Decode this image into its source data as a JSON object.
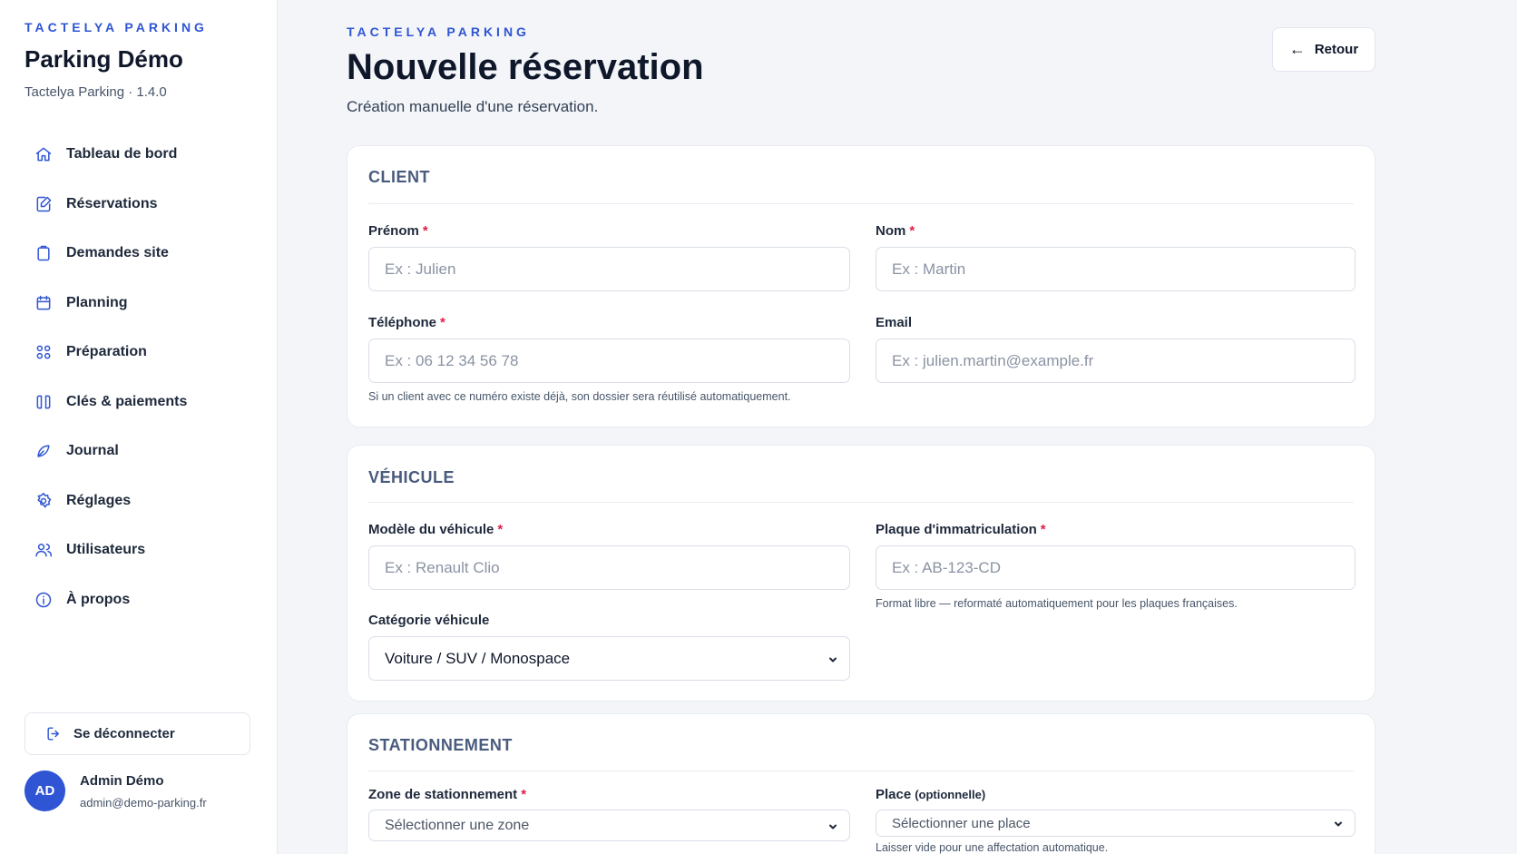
{
  "sidebar": {
    "kicker": "TACTELYA PARKING",
    "title": "Parking Démo",
    "subtitle": "Tactelya Parking · 1.4.0",
    "items": [
      {
        "label": "Tableau de bord",
        "icon": "home-icon"
      },
      {
        "label": "Réservations",
        "icon": "edit-document-icon"
      },
      {
        "label": "Demandes site",
        "icon": "clipboard-icon"
      },
      {
        "label": "Planning",
        "icon": "calendar-icon"
      },
      {
        "label": "Préparation",
        "icon": "grid-dots-icon"
      },
      {
        "label": "Clés & paiements",
        "icon": "keys-icon"
      },
      {
        "label": "Journal",
        "icon": "feather-icon"
      },
      {
        "label": "Réglages",
        "icon": "gear-icon"
      },
      {
        "label": "Utilisateurs",
        "icon": "users-icon"
      },
      {
        "label": "À propos",
        "icon": "info-icon"
      }
    ],
    "logout_label": "Se déconnecter",
    "user": {
      "initials": "AD",
      "name": "Admin Démo",
      "email": "admin@demo-parking.fr"
    }
  },
  "header": {
    "kicker": "TACTELYA PARKING",
    "title": "Nouvelle réservation",
    "subtitle": "Création manuelle d'une réservation.",
    "back_label": "Retour"
  },
  "client": {
    "title": "CLIENT",
    "prenom": {
      "label": "Prénom",
      "placeholder": "Ex : Julien"
    },
    "nom": {
      "label": "Nom",
      "placeholder": "Ex : Martin"
    },
    "telephone": {
      "label": "Téléphone",
      "placeholder": "Ex : 06 12 34 56 78",
      "hint": "Si un client avec ce numéro existe déjà, son dossier sera réutilisé automatiquement."
    },
    "email": {
      "label": "Email",
      "placeholder": "Ex : julien.martin@example.fr"
    }
  },
  "vehicule": {
    "title": "VÉHICULE",
    "modele": {
      "label": "Modèle du véhicule",
      "placeholder": "Ex : Renault Clio"
    },
    "plaque": {
      "label": "Plaque d'immatriculation",
      "placeholder": "Ex : AB-123-CD",
      "hint": "Format libre — reformaté automatiquement pour les plaques françaises."
    },
    "categorie": {
      "label": "Catégorie véhicule",
      "value": "Voiture / SUV / Monospace"
    }
  },
  "stationnement": {
    "title": "STATIONNEMENT",
    "zone": {
      "label": "Zone de stationnement",
      "value": "Sélectionner une zone"
    },
    "place": {
      "label": "Place",
      "optional": "(optionnelle)",
      "value": "Sélectionner une place",
      "hint": "Laisser vide pour une affectation automatique."
    }
  },
  "colors": {
    "accent": "#2f55d4",
    "required": "#e11d48"
  }
}
